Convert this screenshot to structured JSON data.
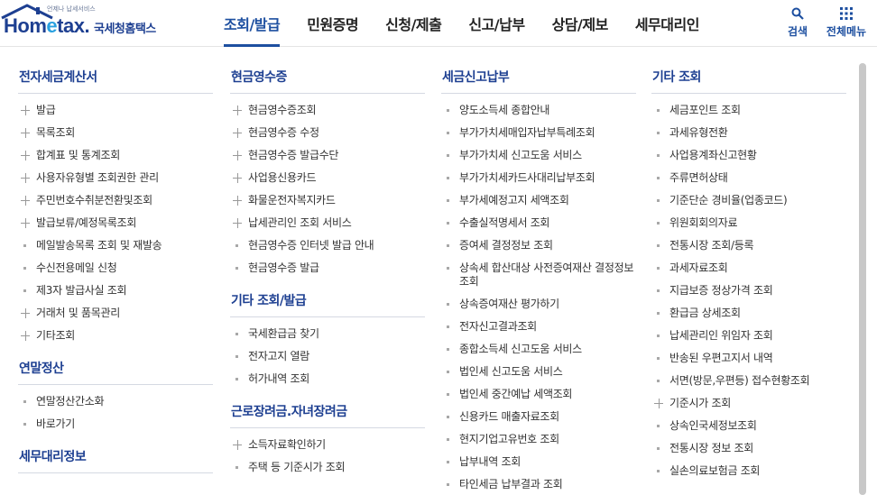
{
  "logo": {
    "sub": "언제나 납세서비스",
    "brand_home": "Hom",
    "brand_e": "e",
    "brand_tax": "tax.",
    "korean": "국세청홈택스"
  },
  "gnb": [
    {
      "label": "조회/발급",
      "active": true
    },
    {
      "label": "민원증명"
    },
    {
      "label": "신청/제출"
    },
    {
      "label": "신고/납부"
    },
    {
      "label": "상담/제보"
    },
    {
      "label": "세무대리인"
    }
  ],
  "util": {
    "search_label": "검색",
    "allmenu_label": "전체메뉴"
  },
  "colors": {
    "brand_navy": "#1d3f91",
    "active_blue": "#1d4fa0",
    "accent_sky": "#2aa1e0"
  },
  "columns": [
    {
      "sections": [
        {
          "title": "전자세금계산서",
          "items": [
            {
              "label": "발급",
              "bullet": "plus"
            },
            {
              "label": "목록조회",
              "bullet": "plus"
            },
            {
              "label": "합계표 및 통계조회",
              "bullet": "plus"
            },
            {
              "label": "사용자유형별 조회권한 관리",
              "bullet": "plus"
            },
            {
              "label": "주민번호수취분전환및조회",
              "bullet": "plus"
            },
            {
              "label": "발급보류/예정목록조회",
              "bullet": "plus"
            },
            {
              "label": "메일발송목록 조회 및 재발송",
              "bullet": "dot"
            },
            {
              "label": "수신전용메일 신청",
              "bullet": "dot"
            },
            {
              "label": "제3자 발급사실 조회",
              "bullet": "dot"
            },
            {
              "label": "거래처 및 품목관리",
              "bullet": "plus"
            },
            {
              "label": "기타조회",
              "bullet": "plus"
            }
          ]
        },
        {
          "title": "연말정산",
          "items": [
            {
              "label": "연말정산간소화",
              "bullet": "dot"
            },
            {
              "label": "바로가기",
              "bullet": "dot"
            }
          ]
        },
        {
          "title": "세무대리정보",
          "items": []
        }
      ]
    },
    {
      "sections": [
        {
          "title": "현금영수증",
          "items": [
            {
              "label": "현금영수증조회",
              "bullet": "plus"
            },
            {
              "label": "현금영수증 수정",
              "bullet": "plus"
            },
            {
              "label": "현금영수증 발급수단",
              "bullet": "plus"
            },
            {
              "label": "사업용신용카드",
              "bullet": "plus"
            },
            {
              "label": "화물운전자복지카드",
              "bullet": "plus"
            },
            {
              "label": "납세관리인 조회 서비스",
              "bullet": "plus"
            },
            {
              "label": "현금영수증 인터넷 발급 안내",
              "bullet": "dot"
            },
            {
              "label": "현금영수증 발급",
              "bullet": "dot"
            }
          ]
        },
        {
          "title": "기타 조회/발급",
          "items": [
            {
              "label": "국세환급금 찾기",
              "bullet": "dot"
            },
            {
              "label": "전자고지 열람",
              "bullet": "dot"
            },
            {
              "label": "허가내역 조회",
              "bullet": "dot"
            }
          ]
        },
        {
          "title": "근로장려금.자녀장려금",
          "items": [
            {
              "label": "소득자료확인하기",
              "bullet": "plus"
            },
            {
              "label": "주택 등 기준시가 조회",
              "bullet": "dot"
            }
          ]
        }
      ]
    },
    {
      "sections": [
        {
          "title": "세금신고납부",
          "items": [
            {
              "label": "양도소득세 종합안내",
              "bullet": "dot"
            },
            {
              "label": "부가가치세매입자납부특례조회",
              "bullet": "dot"
            },
            {
              "label": "부가가치세 신고도움 서비스",
              "bullet": "dot"
            },
            {
              "label": "부가가치세카드사대리납부조회",
              "bullet": "dot"
            },
            {
              "label": "부가세예정고지 세액조회",
              "bullet": "dot"
            },
            {
              "label": "수출실적명세서 조회",
              "bullet": "dot"
            },
            {
              "label": "증여세 결정정보 조회",
              "bullet": "dot"
            },
            {
              "label": "상속세 합산대상 사전증여재산 결정정보 조회",
              "bullet": "dot"
            },
            {
              "label": "상속증여재산 평가하기",
              "bullet": "dot"
            },
            {
              "label": "전자신고결과조회",
              "bullet": "dot"
            },
            {
              "label": "종합소득세 신고도움 서비스",
              "bullet": "dot"
            },
            {
              "label": "법인세 신고도움 서비스",
              "bullet": "dot"
            },
            {
              "label": "법인세 중간예납 세액조회",
              "bullet": "dot"
            },
            {
              "label": "신용카드 매출자료조회",
              "bullet": "dot"
            },
            {
              "label": "현지기업고유번호 조회",
              "bullet": "dot"
            },
            {
              "label": "납부내역 조회",
              "bullet": "dot"
            },
            {
              "label": "타인세금 납부결과 조회",
              "bullet": "dot"
            }
          ]
        }
      ]
    },
    {
      "sections": [
        {
          "title": "기타 조회",
          "items": [
            {
              "label": "세금포인트 조회",
              "bullet": "dot"
            },
            {
              "label": "과세유형전환",
              "bullet": "dot"
            },
            {
              "label": "사업용계좌신고현황",
              "bullet": "dot"
            },
            {
              "label": "주류면허상태",
              "bullet": "dot"
            },
            {
              "label": "기준단순 경비율(업종코드)",
              "bullet": "dot"
            },
            {
              "label": "위원회회의자료",
              "bullet": "dot"
            },
            {
              "label": "전통시장 조회/등록",
              "bullet": "dot"
            },
            {
              "label": "과세자료조회",
              "bullet": "dot"
            },
            {
              "label": "지급보증 정상가격 조회",
              "bullet": "dot"
            },
            {
              "label": "환급금 상세조회",
              "bullet": "dot"
            },
            {
              "label": "납세관리인 위임자 조회",
              "bullet": "dot"
            },
            {
              "label": "반송된 우편고지서 내역",
              "bullet": "dot"
            },
            {
              "label": "서면(방문,우편등) 접수현황조회",
              "bullet": "dot"
            },
            {
              "label": "기준시가 조회",
              "bullet": "plus"
            },
            {
              "label": "상속인국세정보조회",
              "bullet": "dot"
            },
            {
              "label": "전통시장 정보 조회",
              "bullet": "dot"
            },
            {
              "label": "실손의료보험금 조회",
              "bullet": "dot"
            }
          ]
        }
      ]
    }
  ]
}
